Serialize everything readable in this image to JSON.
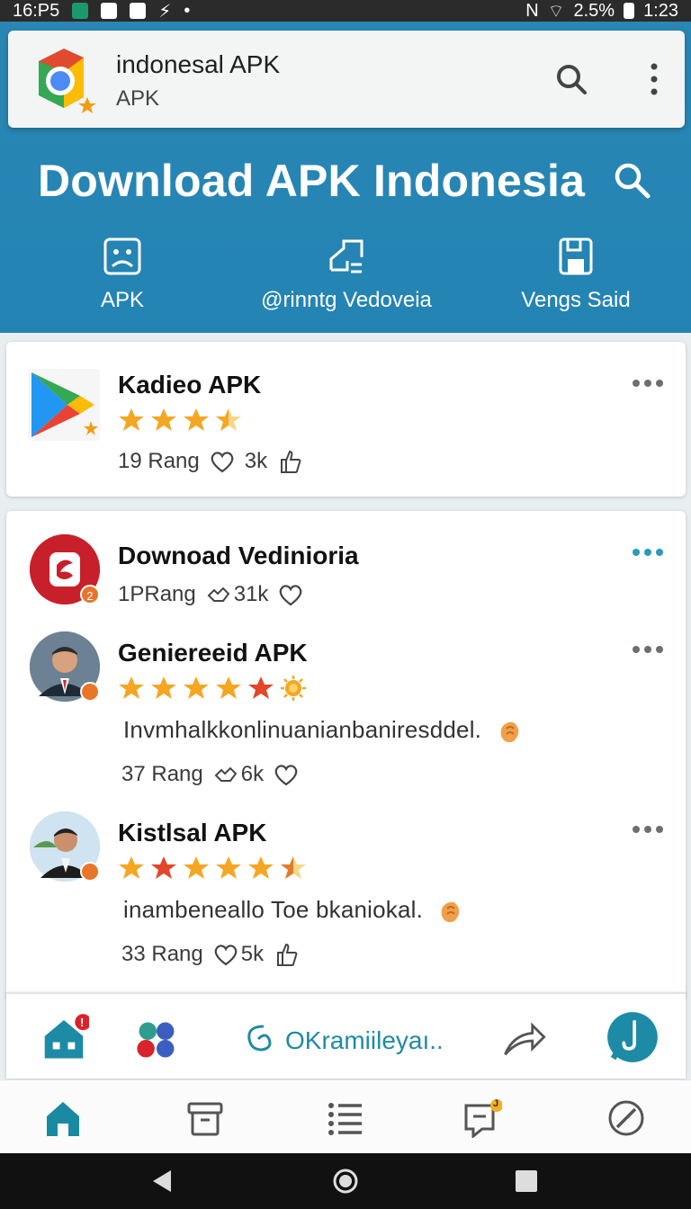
{
  "status_bar": {
    "left_text": "16:P5",
    "battery_percent": "2.5%",
    "time": "1:23"
  },
  "app_bar": {
    "title": "indonesal APK",
    "subtitle": "APK"
  },
  "hero": {
    "title": "Download APK Indonesia"
  },
  "categories": [
    {
      "label": "APK",
      "icon": "image-frame-icon"
    },
    {
      "label": "@rinntg Vedoveia",
      "icon": "share-frame-icon"
    },
    {
      "label": "Vengs Said",
      "icon": "save-disk-icon"
    }
  ],
  "featured": {
    "title": "Kadieo APK",
    "rating_stars": 3.5,
    "rang": "19 Rang",
    "likes": "3k"
  },
  "list": [
    {
      "title": "Downoad Vedinioria",
      "rang": "1PRang",
      "count": "31k",
      "badge": "2"
    },
    {
      "title": "Geniereeid APK",
      "rating_stars": 5,
      "description": "Invmhalkkonlinuanianbaniresddel.",
      "rang": "37 Rang",
      "count": "6k"
    },
    {
      "title": "Kistlsal APK",
      "rating_stars": 4.5,
      "description": "inambeneallo Toe bkaniokal.",
      "rang": "33 Rang",
      "count": "5k"
    }
  ],
  "action_bar": {
    "label": "OKramiileyaı..",
    "home_badge": "!"
  },
  "bottom_nav": {
    "items": [
      "home",
      "archive",
      "list",
      "chat",
      "compass"
    ],
    "chat_badge": "J"
  },
  "colors": {
    "header_blue": "#2384b3",
    "teal": "#1f8aa6",
    "star_gold": "#f5a623"
  }
}
